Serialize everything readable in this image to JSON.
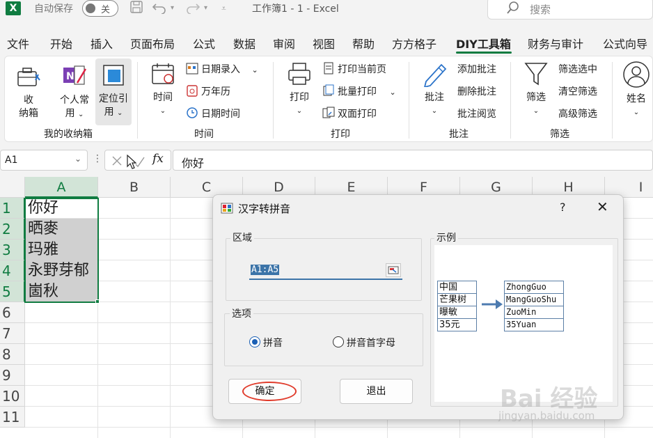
{
  "titlebar": {
    "app_logo": "X",
    "autosave_label": "自动保存",
    "autosave_state": "关",
    "document_title": "工作簿1 - 1 - Excel",
    "search_placeholder": "搜索",
    "icons": [
      "save-icon",
      "undo-icon",
      "redo-icon",
      "customize-qat-icon",
      "search-icon"
    ]
  },
  "menu": {
    "tabs": [
      "文件",
      "开始",
      "插入",
      "页面布局",
      "公式",
      "数据",
      "审阅",
      "视图",
      "帮助",
      "方方格子",
      "DIY工具箱",
      "财务与审计",
      "公式向导"
    ],
    "active": "DIY工具箱"
  },
  "ribbon": {
    "groups": {
      "storage": {
        "label": "我的收纳箱",
        "buttons": [
          {
            "line1": "收",
            "line2": "纳箱",
            "icon": "toolbox-icon"
          },
          {
            "line1": "个人常",
            "line2": "用",
            "icon": "onenote-icon"
          },
          {
            "line1": "定位引",
            "line2": "用",
            "icon": "locate-icon"
          }
        ]
      },
      "time": {
        "label": "时间",
        "big_button": {
          "label": "时间",
          "icon": "calendar-icon"
        },
        "items": [
          {
            "label": "日期录入",
            "icon": "date-entry-icon"
          },
          {
            "label": "万年历",
            "icon": "perpetual-calendar-icon"
          },
          {
            "label": "日期时间",
            "icon": "clock-icon"
          }
        ]
      },
      "print": {
        "label": "打印",
        "big_button": {
          "label": "打印",
          "icon": "printer-icon"
        },
        "items": [
          {
            "label": "打印当前页",
            "icon": "print-page-icon"
          },
          {
            "label": "批量打印",
            "icon": "batch-print-icon"
          },
          {
            "label": "双面打印",
            "icon": "duplex-print-icon"
          }
        ]
      },
      "comment": {
        "label": "批注",
        "big_button": {
          "label": "批注",
          "icon": "pen-icon"
        },
        "items": [
          {
            "label": "添加批注"
          },
          {
            "label": "删除批注"
          },
          {
            "label": "批注阅览"
          }
        ]
      },
      "filter": {
        "label": "筛选",
        "big_button": {
          "label": "筛选",
          "icon": "funnel-icon"
        },
        "items": [
          {
            "label": "筛选选中"
          },
          {
            "label": "清空筛选"
          },
          {
            "label": "高级筛选"
          }
        ]
      },
      "name": {
        "big_button": {
          "label": "姓名",
          "icon": "person-icon"
        }
      }
    }
  },
  "formula_bar": {
    "name_box": "A1",
    "fx_label": "fx",
    "content": "你好"
  },
  "sheet": {
    "columns": [
      "A",
      "B",
      "C",
      "D",
      "E",
      "F",
      "G",
      "H",
      "I"
    ],
    "rows": [
      "1",
      "2",
      "3",
      "4",
      "5",
      "6",
      "7",
      "8",
      "9",
      "10",
      "11"
    ],
    "cells_a": [
      "你好",
      "晒麥",
      "玛雅",
      "永野芽郁",
      "崮秋"
    ]
  },
  "dialog": {
    "title": "汉字转拼音",
    "help": "?",
    "close": "✕",
    "range_group_label": "区域",
    "range_value": "A1:A5",
    "options_group_label": "选项",
    "option_pinyin": "拼音",
    "option_initials": "拼音首字母",
    "selected_option": "拼音",
    "example_label": "示例",
    "example_left": [
      "中国",
      "芒果树",
      "曝敏",
      "35元"
    ],
    "example_right": [
      "ZhongGuo",
      "MangGuoShu",
      "ZuoMin",
      "35Yuan"
    ],
    "ok_label": "确定",
    "exit_label": "退出"
  },
  "watermark": {
    "text": "Bai 经验",
    "url": "jingyan.baidu.com"
  },
  "colors": {
    "excel_green": "#107c41",
    "selection_shade": "#d0d0d0",
    "highlight_red": "#e03a2a",
    "range_blue": "#3c74a8"
  }
}
